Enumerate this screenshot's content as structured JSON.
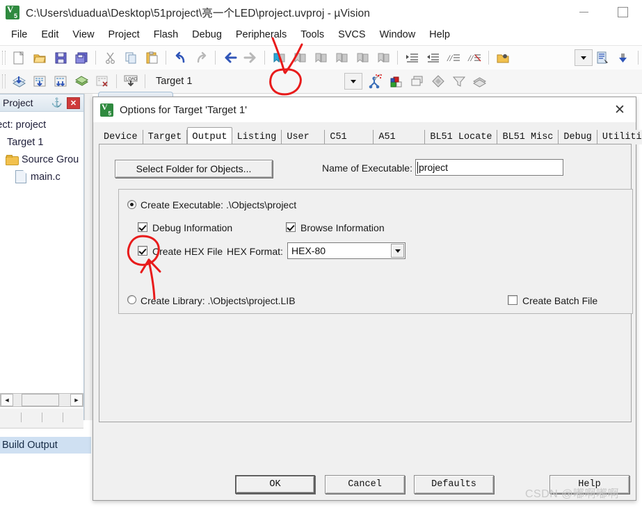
{
  "window": {
    "title": "C:\\Users\\duadua\\Desktop\\51project\\亮一个LED\\project.uvproj - µVision",
    "app_icon": "keil-v5-icon",
    "controls": {
      "minimize": "minimize-icon",
      "maximize": "maximize-icon"
    }
  },
  "menubar": {
    "items": [
      {
        "label": "File"
      },
      {
        "label": "Edit"
      },
      {
        "label": "View"
      },
      {
        "label": "Project"
      },
      {
        "label": "Flash"
      },
      {
        "label": "Debug"
      },
      {
        "label": "Peripherals"
      },
      {
        "label": "Tools"
      },
      {
        "label": "SVCS"
      },
      {
        "label": "Window"
      },
      {
        "label": "Help"
      }
    ]
  },
  "toolbar_main": {
    "buttons": [
      "new-file-icon",
      "open-file-icon",
      "save-icon",
      "save-all-icon",
      "cut-icon",
      "copy-icon",
      "paste-icon",
      "undo-icon",
      "redo-icon",
      "navigate-back-icon",
      "navigate-forward-icon",
      "bookmark-toggle-icon",
      "bookmark-prev-icon",
      "bookmark-next-icon",
      "bookmark-clear-icon",
      "bookmark-all-icon",
      "bookmark-remove-icon",
      "indent-icon",
      "outdent-icon",
      "comment-icon",
      "uncomment-icon",
      "open-folder-icon"
    ],
    "right_buttons": [
      "combo-dropdown-icon",
      "insert-file-icon",
      "download-icon"
    ]
  },
  "toolbar_build": {
    "buttons": [
      "translate-icon",
      "build-icon",
      "rebuild-icon",
      "batch-build-icon",
      "stop-build-icon",
      "load-icon"
    ],
    "target_selector": "Target 1",
    "target_dropdown": "chevron-down-icon",
    "options_target_icon": "options-for-target-icon",
    "manage_project_icon": "manage-project-items-icon",
    "right_buttons": [
      "books-icon",
      "window-icon",
      "diamond-icon",
      "filter-icon",
      "layers-icon"
    ]
  },
  "project_panel": {
    "title": "Project",
    "pin_icon": "pin-icon",
    "close_icon": "close-icon",
    "tree": [
      {
        "label": "oject: project",
        "icon": "project-icon",
        "level": 0
      },
      {
        "label": "Target 1",
        "icon": "target-icon",
        "level": 1
      },
      {
        "label": "Source Grou",
        "icon": "folder-icon",
        "level": 2
      },
      {
        "label": "main.c",
        "icon": "c-file-icon",
        "level": 3
      }
    ],
    "hscroll": {
      "left_arrow": "◄",
      "right_arrow": "►"
    }
  },
  "build_output": {
    "label": "Build Output"
  },
  "dialog": {
    "icon": "keil-v5-icon",
    "title": "Options for Target 'Target 1'",
    "close_label": "✕",
    "tabs": [
      {
        "label": "Device",
        "active": false
      },
      {
        "label": "Target",
        "active": false
      },
      {
        "label": "Output",
        "active": true
      },
      {
        "label": "Listing",
        "active": false
      },
      {
        "label": "User",
        "active": false
      },
      {
        "label": "C51",
        "active": false
      },
      {
        "label": "A51",
        "active": false
      },
      {
        "label": "BL51 Locate",
        "active": false
      },
      {
        "label": "BL51 Misc",
        "active": false
      },
      {
        "label": "Debug",
        "active": false
      },
      {
        "label": "Utilities",
        "active": false
      }
    ],
    "output_tab": {
      "select_folder_button": "Select Folder for Objects...",
      "name_of_executable_label": "Name of Executable:",
      "name_of_executable_value": "project",
      "create_executable": {
        "label": "Create Executable:  .\\Objects\\project",
        "selected": true
      },
      "debug_information": {
        "label": "Debug Information",
        "checked": true
      },
      "browse_information": {
        "label": "Browse Information",
        "checked": true
      },
      "create_hex_file": {
        "label": "Create HEX File",
        "checked": true
      },
      "hex_format_label": "HEX Format:",
      "hex_format_value": "HEX-80",
      "create_library": {
        "label": "Create Library:  .\\Objects\\project.LIB",
        "selected": false
      },
      "create_batch_file": {
        "label": "Create Batch File",
        "checked": false
      }
    },
    "buttons": {
      "ok": "OK",
      "cancel": "Cancel",
      "defaults": "Defaults",
      "help": "Help"
    }
  },
  "annotations": {
    "color": "#e81b1b",
    "items": [
      {
        "name": "circle-around-options-for-target-icon",
        "shape": "circle"
      },
      {
        "name": "arrow-to-options-for-target-icon",
        "shape": "arrow"
      },
      {
        "name": "circle-around-create-hex-checkbox",
        "shape": "circle"
      },
      {
        "name": "arrow-to-create-hex-checkbox",
        "shape": "arrow"
      }
    ]
  },
  "watermark": {
    "text": "CSDN @嘟啊嘟啊"
  }
}
